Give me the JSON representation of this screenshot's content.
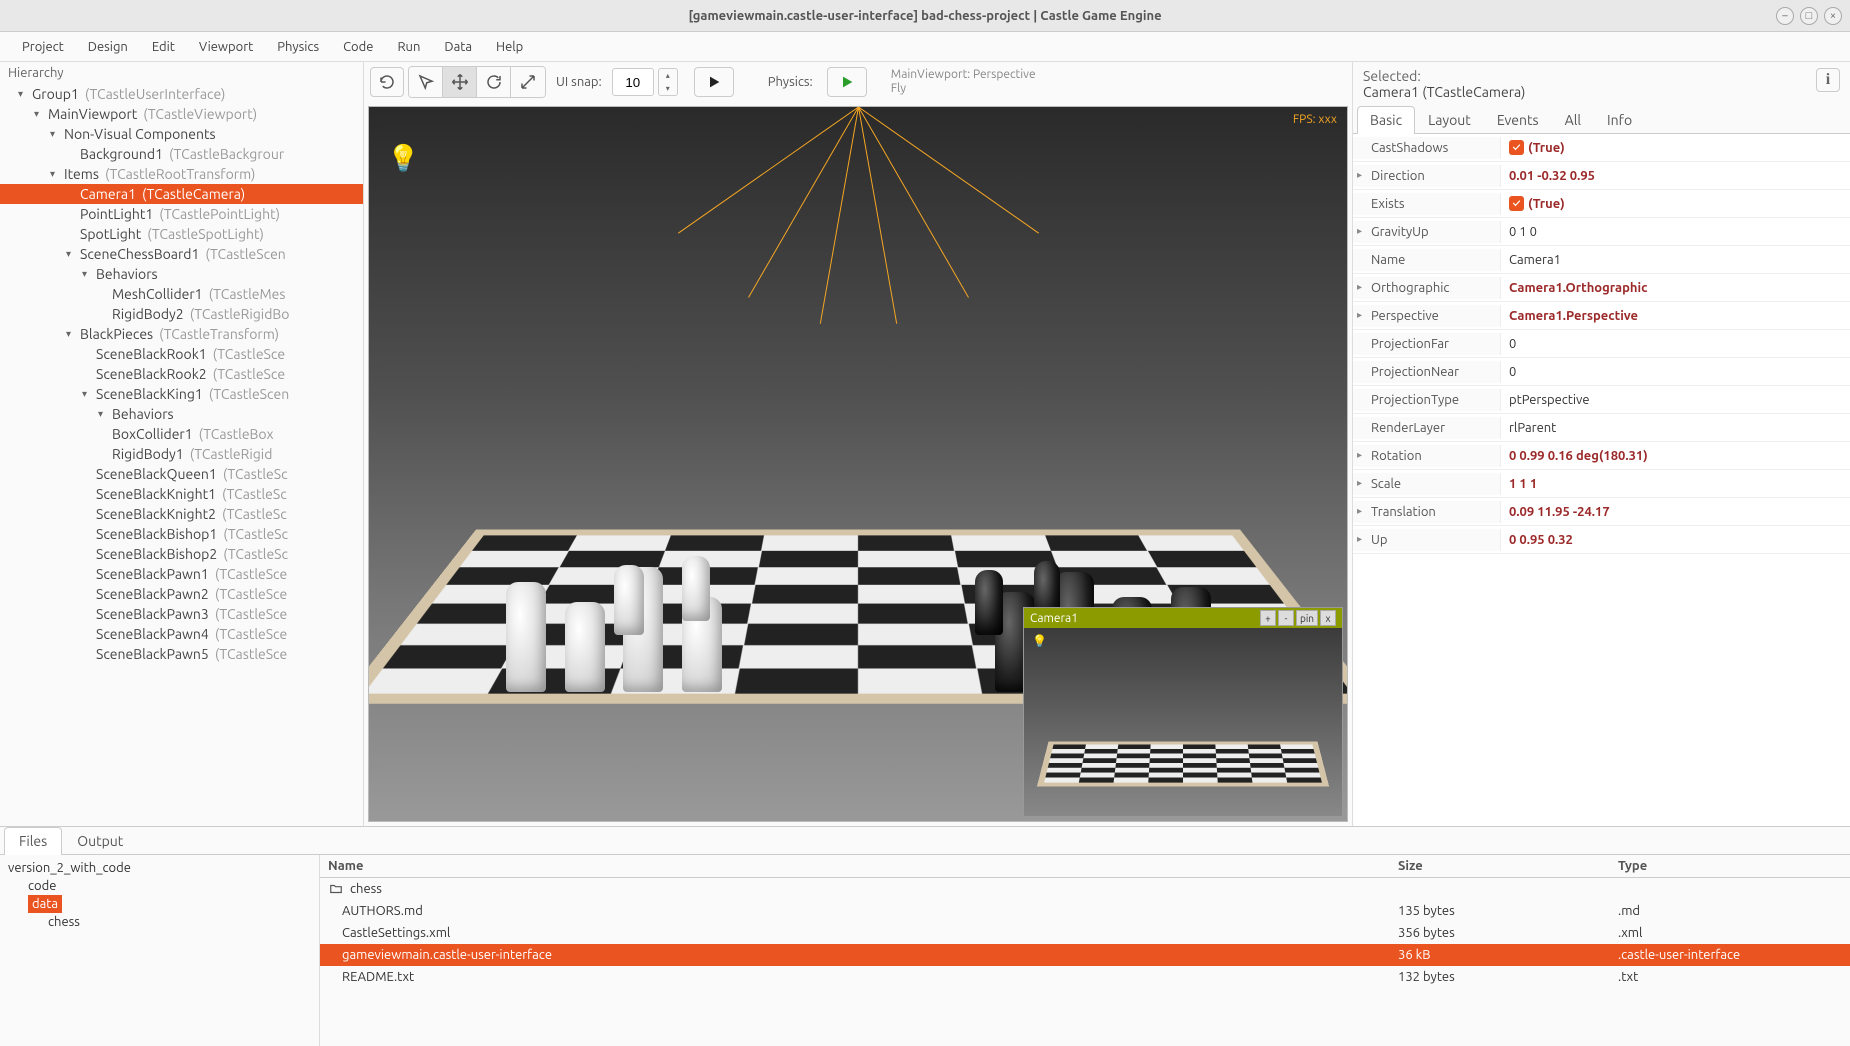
{
  "window": {
    "title": "[gameviewmain.castle-user-interface] bad-chess-project | Castle Game Engine"
  },
  "menu": [
    "Project",
    "Design",
    "Edit",
    "Viewport",
    "Physics",
    "Code",
    "Run",
    "Data",
    "Help"
  ],
  "hierarchy": {
    "title": "Hierarchy",
    "nodes": [
      {
        "d": 1,
        "tog": "▾",
        "name": "Group1",
        "type": "(TCastleUserInterface)"
      },
      {
        "d": 2,
        "tog": "▾",
        "name": "MainViewport",
        "type": "(TCastleViewport)"
      },
      {
        "d": 3,
        "tog": "▾",
        "name": "Non-Visual Components",
        "type": ""
      },
      {
        "d": 4,
        "tog": "",
        "name": "Background1",
        "type": "(TCastleBackgrour"
      },
      {
        "d": 3,
        "tog": "▾",
        "name": "Items",
        "type": "(TCastleRootTransform)"
      },
      {
        "d": 4,
        "tog": "",
        "name": "Camera1",
        "type": "(TCastleCamera)",
        "sel": true
      },
      {
        "d": 4,
        "tog": "",
        "name": "PointLight1",
        "type": "(TCastlePointLight)"
      },
      {
        "d": 4,
        "tog": "",
        "name": "SpotLight",
        "type": "(TCastleSpotLight)"
      },
      {
        "d": 4,
        "tog": "▾",
        "name": "SceneChessBoard1",
        "type": "(TCastleScen"
      },
      {
        "d": 5,
        "tog": "▾",
        "name": "Behaviors",
        "type": ""
      },
      {
        "d": 6,
        "tog": "",
        "name": "MeshCollider1",
        "type": "(TCastleMes"
      },
      {
        "d": 6,
        "tog": "",
        "name": "RigidBody2",
        "type": "(TCastleRigidBo"
      },
      {
        "d": 4,
        "tog": "▾",
        "name": "BlackPieces",
        "type": "(TCastleTransform)"
      },
      {
        "d": 5,
        "tog": "",
        "name": "SceneBlackRook1",
        "type": "(TCastleSce"
      },
      {
        "d": 5,
        "tog": "",
        "name": "SceneBlackRook2",
        "type": "(TCastleSce"
      },
      {
        "d": 5,
        "tog": "▾",
        "name": "SceneBlackKing1",
        "type": "(TCastleScen"
      },
      {
        "d": 6,
        "tog": "▾",
        "name": "Behaviors",
        "type": ""
      },
      {
        "d": 6,
        "tog": "",
        "name": "BoxCollider1",
        "type": "(TCastleBox"
      },
      {
        "d": 6,
        "tog": "",
        "name": "RigidBody1",
        "type": "(TCastleRigid"
      },
      {
        "d": 5,
        "tog": "",
        "name": "SceneBlackQueen1",
        "type": "(TCastleSc"
      },
      {
        "d": 5,
        "tog": "",
        "name": "SceneBlackKnight1",
        "type": "(TCastleSc"
      },
      {
        "d": 5,
        "tog": "",
        "name": "SceneBlackKnight2",
        "type": "(TCastleSc"
      },
      {
        "d": 5,
        "tog": "",
        "name": "SceneBlackBishop1",
        "type": "(TCastleSc"
      },
      {
        "d": 5,
        "tog": "",
        "name": "SceneBlackBishop2",
        "type": "(TCastleSc"
      },
      {
        "d": 5,
        "tog": "",
        "name": "SceneBlackPawn1",
        "type": "(TCastleSce"
      },
      {
        "d": 5,
        "tog": "",
        "name": "SceneBlackPawn2",
        "type": "(TCastleSce"
      },
      {
        "d": 5,
        "tog": "",
        "name": "SceneBlackPawn3",
        "type": "(TCastleSce"
      },
      {
        "d": 5,
        "tog": "",
        "name": "SceneBlackPawn4",
        "type": "(TCastleSce"
      },
      {
        "d": 5,
        "tog": "",
        "name": "SceneBlackPawn5",
        "type": "(TCastleSce"
      }
    ]
  },
  "toolbar": {
    "ui_snap_label": "UI snap:",
    "ui_snap_value": "10",
    "physics_label": "Physics:",
    "viewport_info_1": "MainViewport: Perspective",
    "viewport_info_2": "Fly"
  },
  "viewport": {
    "fps": "FPS: xxx",
    "cam_preview_title": "Camera1",
    "preview_btns": [
      "+",
      "-",
      "pin",
      "x"
    ]
  },
  "inspector": {
    "selected_label": "Selected:",
    "selected_value": "Camera1 (TCastleCamera)",
    "tabs": [
      "Basic",
      "Layout",
      "Events",
      "All",
      "Info"
    ],
    "props": [
      {
        "k": "CastShadows",
        "v": "(True)",
        "check": true
      },
      {
        "k": "Direction",
        "v": "0.01 -0.32 0.95",
        "bold": true,
        "ar": true
      },
      {
        "k": "Exists",
        "v": "(True)",
        "check": true
      },
      {
        "k": "GravityUp",
        "v": "0 1 0",
        "ar": true
      },
      {
        "k": "Name",
        "v": "Camera1"
      },
      {
        "k": "Orthographic",
        "v": "Camera1.Orthographic",
        "bold": true,
        "ar": true
      },
      {
        "k": "Perspective",
        "v": "Camera1.Perspective",
        "bold": true,
        "ar": true
      },
      {
        "k": "ProjectionFar",
        "v": "0"
      },
      {
        "k": "ProjectionNear",
        "v": "0"
      },
      {
        "k": "ProjectionType",
        "v": "ptPerspective"
      },
      {
        "k": "RenderLayer",
        "v": "rlParent"
      },
      {
        "k": "Rotation",
        "v": "0 0.99 0.16 deg(180.31)",
        "bold": true,
        "ar": true
      },
      {
        "k": "Scale",
        "v": "1 1 1",
        "bold": true,
        "ar": true
      },
      {
        "k": "Translation",
        "v": "0.09 11.95 -24.17",
        "bold": true,
        "ar": true
      },
      {
        "k": "Up",
        "v": "0 0.95 0.32",
        "bold": true,
        "ar": true
      }
    ]
  },
  "bottom": {
    "tabs": [
      "Files",
      "Output"
    ],
    "folder_tree": {
      "root": "version_2_with_code",
      "children": [
        "code",
        "data"
      ],
      "sel": "data",
      "sub": "chess"
    },
    "file_headers": [
      "Name",
      "Size",
      "Type"
    ],
    "files": [
      {
        "name": "chess",
        "size": "",
        "type": "",
        "folder": true
      },
      {
        "name": "AUTHORS.md",
        "size": "135 bytes",
        "type": ".md"
      },
      {
        "name": "CastleSettings.xml",
        "size": "356 bytes",
        "type": ".xml"
      },
      {
        "name": "gameviewmain.castle-user-interface",
        "size": "36 kB",
        "type": ".castle-user-interface",
        "sel": true
      },
      {
        "name": "README.txt",
        "size": "132 bytes",
        "type": ".txt"
      }
    ]
  }
}
